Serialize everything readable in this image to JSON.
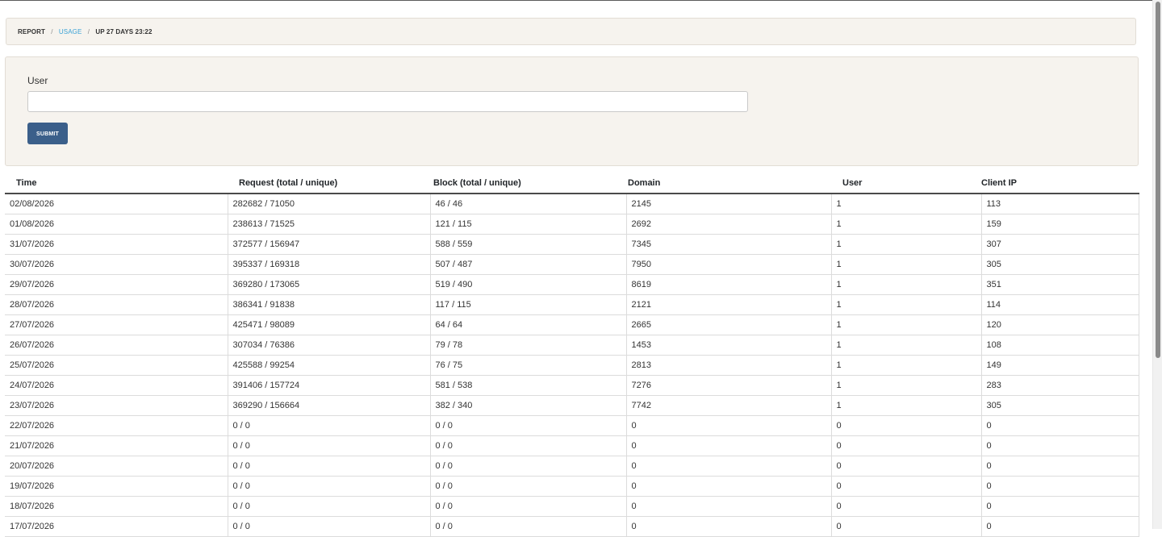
{
  "breadcrumb": {
    "report": "REPORT",
    "sep": "/",
    "usage": "USAGE",
    "uptime": "UP 27 DAYS 23:22"
  },
  "form": {
    "user_label": "User",
    "user_value": "",
    "submit_label": "SUBMIT"
  },
  "table": {
    "headers": [
      "Time",
      "Request (total / unique)",
      "Block (total / unique)",
      "Domain",
      "User",
      "Client IP"
    ],
    "rows": [
      [
        "02/08/2026",
        "282682 / 71050",
        "46 / 46",
        "2145",
        "1",
        "113"
      ],
      [
        "01/08/2026",
        "238613 / 71525",
        "121 / 115",
        "2692",
        "1",
        "159"
      ],
      [
        "31/07/2026",
        "372577 / 156947",
        "588 / 559",
        "7345",
        "1",
        "307"
      ],
      [
        "30/07/2026",
        "395337 / 169318",
        "507 / 487",
        "7950",
        "1",
        "305"
      ],
      [
        "29/07/2026",
        "369280 / 173065",
        "519 / 490",
        "8619",
        "1",
        "351"
      ],
      [
        "28/07/2026",
        "386341 / 91838",
        "117 / 115",
        "2121",
        "1",
        "114"
      ],
      [
        "27/07/2026",
        "425471 / 98089",
        "64 / 64",
        "2665",
        "1",
        "120"
      ],
      [
        "26/07/2026",
        "307034 / 76386",
        "79 / 78",
        "1453",
        "1",
        "108"
      ],
      [
        "25/07/2026",
        "425588 / 99254",
        "76 / 75",
        "2813",
        "1",
        "149"
      ],
      [
        "24/07/2026",
        "391406 / 157724",
        "581 / 538",
        "7276",
        "1",
        "283"
      ],
      [
        "23/07/2026",
        "369290 / 156664",
        "382 / 340",
        "7742",
        "1",
        "305"
      ],
      [
        "22/07/2026",
        "0 / 0",
        "0 / 0",
        "0",
        "0",
        "0"
      ],
      [
        "21/07/2026",
        "0 / 0",
        "0 / 0",
        "0",
        "0",
        "0"
      ],
      [
        "20/07/2026",
        "0 / 0",
        "0 / 0",
        "0",
        "0",
        "0"
      ],
      [
        "19/07/2026",
        "0 / 0",
        "0 / 0",
        "0",
        "0",
        "0"
      ],
      [
        "18/07/2026",
        "0 / 0",
        "0 / 0",
        "0",
        "0",
        "0"
      ],
      [
        "17/07/2026",
        "0 / 0",
        "0 / 0",
        "0",
        "0",
        "0"
      ]
    ]
  },
  "colors": {
    "panel_bg": "#f6f3ee",
    "link": "#3aa2d6",
    "button": "#3b5f8a"
  }
}
